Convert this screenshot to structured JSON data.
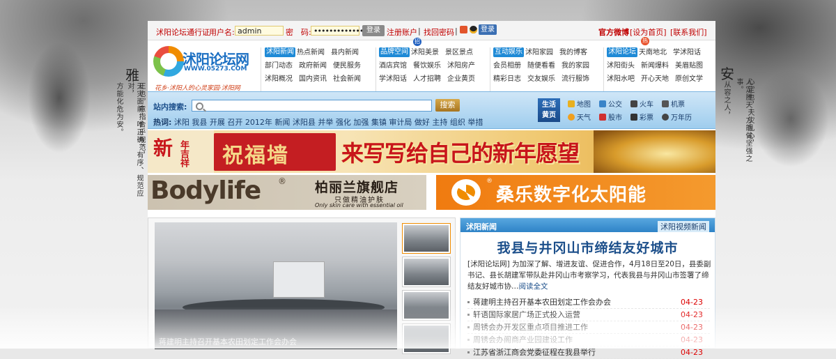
{
  "side": {
    "left_big": "雅",
    "left_text1": "正也。意指合乎规范，",
    "left_text2": "方能化危为安。",
    "left_text3": "天灾面前，唯正确、有序、规范应对，",
    "right_big": "安",
    "right_text1": "心定也，天灾乱心，",
    "right_text2": "人定胜天，方能做坚强之事。",
    "right_text3": "从容之人，"
  },
  "topbar": {
    "pass_label": "沭阳论坛通行证",
    "username_label": "用户名:",
    "username_value": "admin",
    "password_label": "密　码:",
    "password_value": "••••••••••••••",
    "login_button": "登录",
    "register_link": "注册账户",
    "sep": "|",
    "recover_link": "找回密码",
    "qq_login": "登录",
    "weibo_link": "官方微博",
    "homepage_link": "[设为首页]",
    "contact_link": "[联系我们]"
  },
  "logo": {
    "title": "沭阳论坛网",
    "url": "WWW.05273.COM",
    "slogan": "花乡·沭阳人的心灵家园·沭阳网"
  },
  "nav": {
    "g1": {
      "tag": "沭阳新闻",
      "row1": [
        "热点新闻",
        "县内新闻"
      ],
      "row2": [
        "部门动态",
        "政府新闻",
        "便民服务"
      ],
      "row3": [
        "沭阳概况",
        "国内资讯",
        "社会新闻"
      ]
    },
    "g2": {
      "tag": "品牌空间",
      "badge": "招",
      "row1": [
        "沭阳美景",
        "景区景点"
      ],
      "row2": [
        "酒店宾馆",
        "餐饮娱乐",
        "沭阳房产"
      ],
      "row3": [
        "学沭阳话",
        "人才招聘",
        "企业黄页"
      ]
    },
    "g3": {
      "tag": "互动娱乐",
      "row1": [
        "沭阳家园",
        "我的博客"
      ],
      "row2": [
        "会员相册",
        "随便看看",
        "我的家园"
      ],
      "row3": [
        "精彩日志",
        "交友娱乐",
        "流行服饰"
      ]
    },
    "g4": {
      "tag": "沭阳论坛",
      "badge": "热",
      "row1": [
        "天南地北",
        "学沭阳话"
      ],
      "row2": [
        "沭阳街头",
        "新闻爆料",
        "美眉贴图"
      ],
      "row3": [
        "沭阳水吧",
        "开心天地",
        "原创文学"
      ]
    }
  },
  "search": {
    "label": "站内搜索:",
    "placeholder": "",
    "button": "搜索",
    "hot_label": "热词:",
    "hot_words": "沭阳 我县 开展 召开 2012年 新闻 沭阳县 并举 强化 加强 集镇 审计局 做好 主持 组织 举措"
  },
  "life": {
    "label1": "生活",
    "label2": "黄页",
    "items": [
      {
        "text": "地图",
        "color": "#e8b020"
      },
      {
        "text": "公交",
        "color": "#3a84c8"
      },
      {
        "text": "火车",
        "color": "#444444"
      },
      {
        "text": "机票",
        "color": "#555555"
      },
      {
        "text": "天气",
        "color": "#f0a020"
      },
      {
        "text": "股市",
        "color": "#d03030"
      },
      {
        "text": "彩票",
        "color": "#333333"
      },
      {
        "text": "万年历",
        "color": "#444444"
      }
    ]
  },
  "banners": {
    "b1_year": "新",
    "b1_year_small": "年吉祥",
    "b1_blessing": "祝福墙",
    "b1_slogan": "来写写给自己的新年愿望",
    "b2_brand": "Bodylife",
    "b2_reg": "®",
    "b2_store": "柏丽兰旗舰店",
    "b2_sub": "只做精油护肤",
    "b2_en": "Only skin care with essential oil",
    "b3_reg": "®",
    "b3_title": "桑乐数字化太阳能"
  },
  "photo": {
    "caption": "蒋建明主持召开基本农田划定工作会办会"
  },
  "news": {
    "tab_active": "沭阳新闻",
    "tab_other": "沭阳视频新闻",
    "headline": "我县与井冈山市缔结友好城市",
    "summary": "[沭阳论坛网] 为加深了解、增进友谊、促进合作，4月18日至20日，县委副书记、县长胡建军带队赴井冈山市考察学习，代表我县与井冈山市签署了缔结友好城市协…",
    "read_more": "阅读全文",
    "items": [
      {
        "title": "蒋建明主持召开基本农田划定工作会办会",
        "date": "04-23"
      },
      {
        "title": "轩语国际家居广场正式投入运营",
        "date": "04-23"
      },
      {
        "title": "周锈会办开发区重点项目推进工作",
        "date": "04-23"
      },
      {
        "title": "周锈会办阁商产业园建设工作",
        "date": "04-23"
      },
      {
        "title": "江苏省浙江商会党委征程在我县举行",
        "date": "04-23"
      }
    ]
  }
}
